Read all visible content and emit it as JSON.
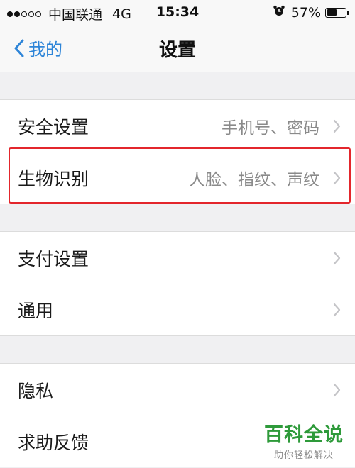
{
  "status_bar": {
    "carrier": "中国联通",
    "network": "4G",
    "time": "15:34",
    "battery_text": "57%",
    "battery_level": 0.57
  },
  "nav": {
    "back_label": "我的",
    "title": "设置"
  },
  "groups": [
    {
      "items": [
        {
          "label": "安全设置",
          "value": "手机号、密码"
        },
        {
          "label": "生物识别",
          "value": "人脸、指纹、声纹"
        }
      ]
    },
    {
      "items": [
        {
          "label": "支付设置",
          "value": ""
        },
        {
          "label": "通用",
          "value": ""
        }
      ]
    },
    {
      "items": [
        {
          "label": "隐私",
          "value": ""
        },
        {
          "label": "求助反馈",
          "value": ""
        }
      ]
    }
  ],
  "watermark": {
    "title": "百科全说",
    "subtitle": "助你轻松解决"
  },
  "colors": {
    "accent": "#2e85d8",
    "highlight_border": "#e3262c",
    "watermark_green": "#2e9a3a",
    "background": "#f0f0f2"
  }
}
